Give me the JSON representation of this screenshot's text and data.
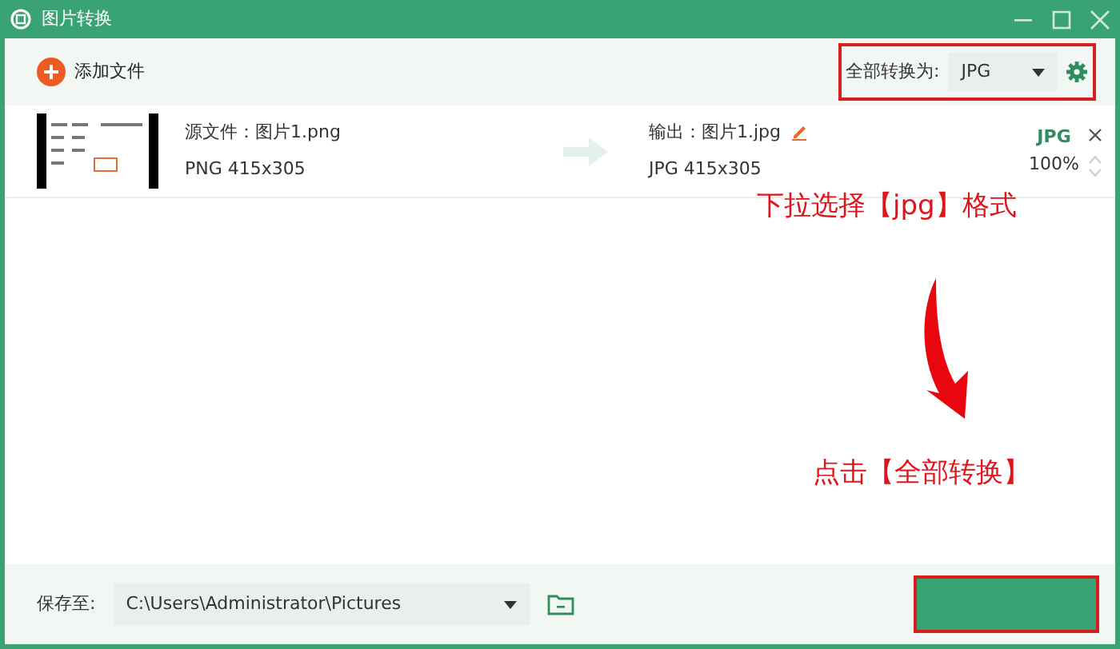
{
  "window": {
    "title": "图片转换"
  },
  "toolbar": {
    "add_label": "添加文件",
    "convert_all_label": "全部转换为:",
    "format": "JPG",
    "annotated": true
  },
  "files": [
    {
      "source": "源文件：图片1.png",
      "source_info": "PNG  415x305",
      "output": "输出：图片1.jpg",
      "output_info": "JPG  415x305",
      "format": "JPG",
      "quality": "100%"
    }
  ],
  "annotations": [
    {
      "text": "下拉选择【jpg】格式"
    },
    {
      "text": "点击【全部转换】"
    }
  ],
  "footer": {
    "save_label": "保存至:",
    "path": "C:\\Users\\Administrator\\Pictures",
    "convert_button_annotated": true
  }
}
